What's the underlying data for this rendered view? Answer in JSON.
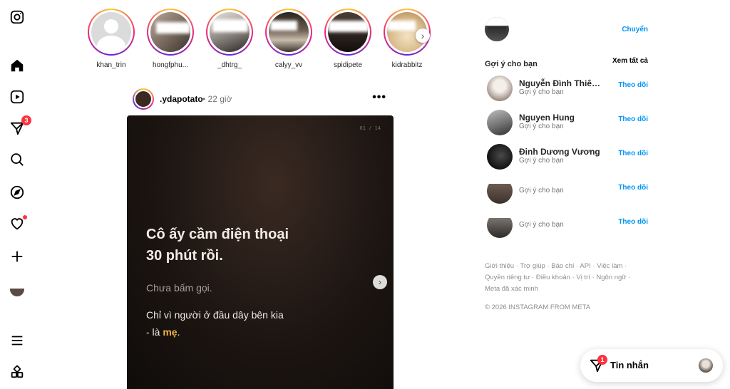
{
  "nav": {
    "badge_notifications": "3"
  },
  "stories": [
    {
      "name": "khan_trin"
    },
    {
      "name": "hongfphu..."
    },
    {
      "name": "_dhtrg_"
    },
    {
      "name": "calyy_vv"
    },
    {
      "name": "spidipete"
    },
    {
      "name": "kidrabbitz"
    }
  ],
  "post": {
    "username": ".ydapotato",
    "time": "• 22 giờ",
    "more": "•••",
    "slide_counter": "01 / 14",
    "headline_1": "Cô ấy cầm điện thoại",
    "headline_2": "30 phút rồi.",
    "subline": "Chưa bấm gọi.",
    "body_1": "Chỉ vì người ở đầu dây bên kia",
    "body_2_prefix": "- là ",
    "body_2_highlight": "mẹ",
    "body_2_suffix": "."
  },
  "sidebar": {
    "switch_label": "Chuyển",
    "suggestions_title": "Gợi ý cho bạn",
    "see_all": "Xem tất cả",
    "suggestions": [
      {
        "name": "Nguyễn Đình Thiên...",
        "sub": "Gợi ý cho bạn",
        "action": "Theo dõi"
      },
      {
        "name": "Nguyen Hung",
        "sub": "Gợi ý cho bạn",
        "action": "Theo dõi"
      },
      {
        "name": "Đinh Dương Vương",
        "sub": "Gợi ý cho bạn",
        "action": "Theo dõi"
      },
      {
        "name": "",
        "sub": "Gợi ý cho bạn",
        "action": "Theo dõi"
      },
      {
        "name": "",
        "sub": "Gợi ý cho bạn",
        "action": "Theo dõi"
      }
    ],
    "footer_links": [
      "Giới thiệu",
      "Trợ giúp",
      "Báo chí",
      "API",
      "Việc làm",
      "Quyền riêng tư",
      "Điều khoản",
      "Vị trí",
      "Ngôn ngữ",
      "Meta đã xác minh"
    ],
    "copyright": "© 2026 INSTAGRAM FROM META"
  },
  "messages": {
    "label": "Tin nhắn",
    "badge": "1"
  },
  "colors": {
    "link_blue": "#0095f6",
    "badge_red": "#ff3040",
    "highlight_orange": "#f0b446"
  }
}
